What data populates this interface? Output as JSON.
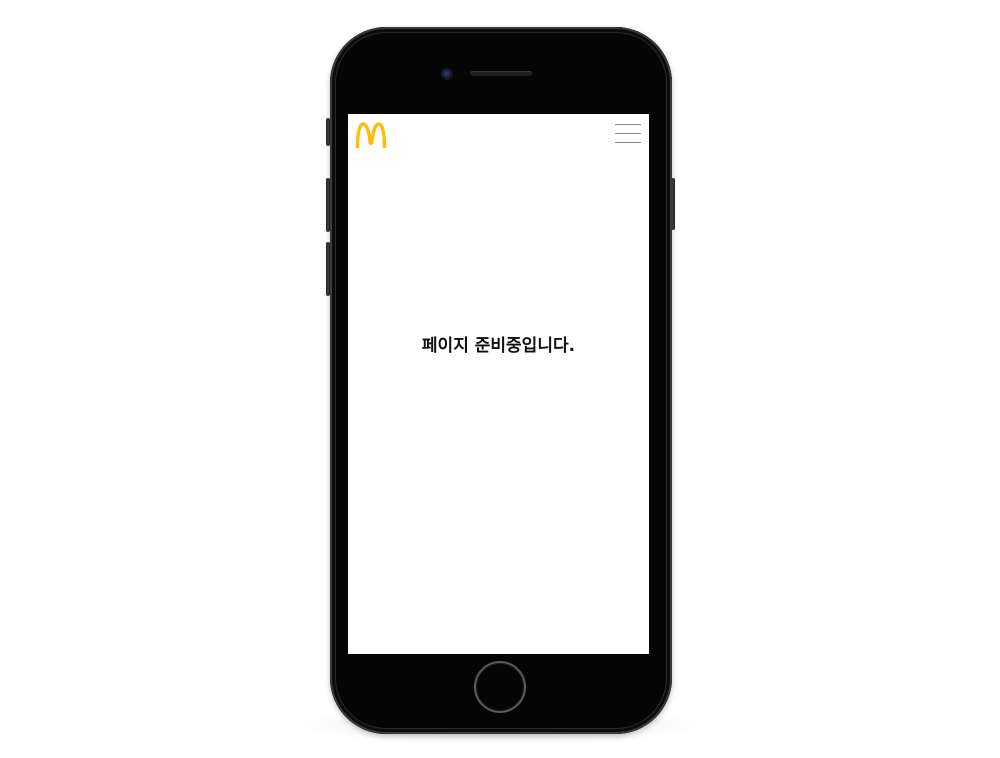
{
  "page": {
    "message": "페이지 준비중입니다."
  },
  "header": {
    "logo_icon": "mcdonalds-golden-arches-logo",
    "logo_color": "#FFBC0D",
    "menu_icon": "hamburger-menu-icon"
  },
  "device": {
    "frame_color": "#050505",
    "screen_color": "#ffffff"
  }
}
